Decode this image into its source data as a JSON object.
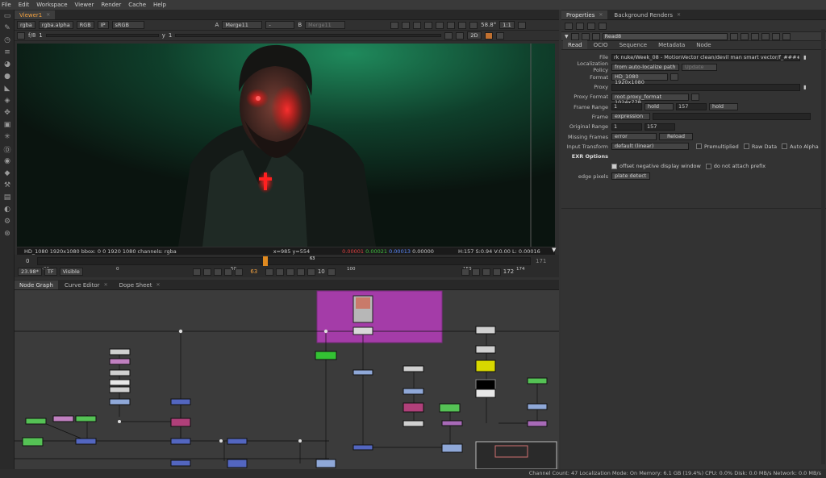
{
  "menubar": {
    "items": [
      "File",
      "Edit",
      "Workspace",
      "Viewer",
      "Render",
      "Cache",
      "Help"
    ]
  },
  "viewer": {
    "tab_label": "Viewer1",
    "channels": "rgba",
    "alpha_channel": "rgba.alpha",
    "display": "RGB",
    "ip_label": "IP",
    "colorspace": "sRGB",
    "input_a_label": "A",
    "input_a_value": "Merge11",
    "compare_value": "-",
    "input_b_label": "B",
    "input_b_value": "Merge11",
    "gain_label": "f/8",
    "gain_value": "1",
    "gamma_label": "y",
    "gamma_value": "1",
    "zoom": "58.8°",
    "proxy": "1:1",
    "view_mode": "2D",
    "info": {
      "format": "HD_1080 1920x1080",
      "bbox": "bbox: 0 0 1920 1080 channels: rgba",
      "coords": "x=985 y=554",
      "r": "0.00001",
      "g": "0.00021",
      "b": "0.00013",
      "a": "0.00000",
      "hsl": "H:157 S:0.94 V:0.00  L: 0.00016"
    }
  },
  "timeline": {
    "start": "0",
    "ticks": [
      "-33",
      "0",
      "50",
      "100",
      "150",
      "174"
    ],
    "end": "171",
    "current_frame_marker": "63",
    "fps": "23.98*",
    "tf": "TF",
    "visible": "Visible",
    "frame": "63",
    "increment": "10",
    "last_frame": "172",
    "current_frame_fraction": 0.46
  },
  "nodegraph": {
    "tabs": [
      "Node Graph",
      "Curve Editor",
      "Dope Sheet"
    ]
  },
  "properties": {
    "tabs": [
      "Properties",
      "Background Renders"
    ],
    "node_name": "Read8",
    "subtabs": [
      "Read",
      "OCIO",
      "Sequence",
      "Metadata",
      "Node"
    ],
    "file_label": "File",
    "file_value": "rk nuke/Week_08 - MotionVector clean/devil man smart vector/f_####.exr",
    "localization_label": "Localization Policy",
    "localization_value": "from auto-localize path",
    "update_label": "Update",
    "format_label": "Format",
    "format_value": "HD_1080 1920x1080",
    "proxy_label": "Proxy",
    "proxy_format_label": "Proxy Format",
    "proxy_format_value": "root.proxy_format 1024x778",
    "frame_range_label": "Frame Range",
    "frame_range_start": "1",
    "frame_range_before": "hold",
    "frame_range_end": "157",
    "frame_range_after": "hold",
    "frame_label": "Frame",
    "frame_mode": "expression",
    "original_range_label": "Original Range",
    "original_start": "1",
    "original_end": "157",
    "missing_frames_label": "Missing Frames",
    "missing_frames_value": "error",
    "reload_label": "Reload",
    "input_transform_label": "Input Transform",
    "input_transform_value": "default (linear)",
    "premultiplied_label": "Premultiplied",
    "raw_data_label": "Raw Data",
    "auto_alpha_label": "Auto Alpha",
    "exr_options_label": "EXR Options",
    "offset_label": "offset negative display window",
    "do_not_attach_label": "do not attach prefix",
    "edge_pixels_label": "edge pixels",
    "edge_pixels_value": "plate detect"
  },
  "status_bar": "Channel Count: 47  Localization Mode: On  Memory: 6.1 GB (19.4%)  CPU: 0.0%  Disk: 0.0 MB/s  Network: 0.0 MB/s",
  "colors": {
    "accent": "#f0a040",
    "backdrop": "#a43ca8",
    "node_blue": "#5366c0",
    "node_green": "#38b838"
  }
}
